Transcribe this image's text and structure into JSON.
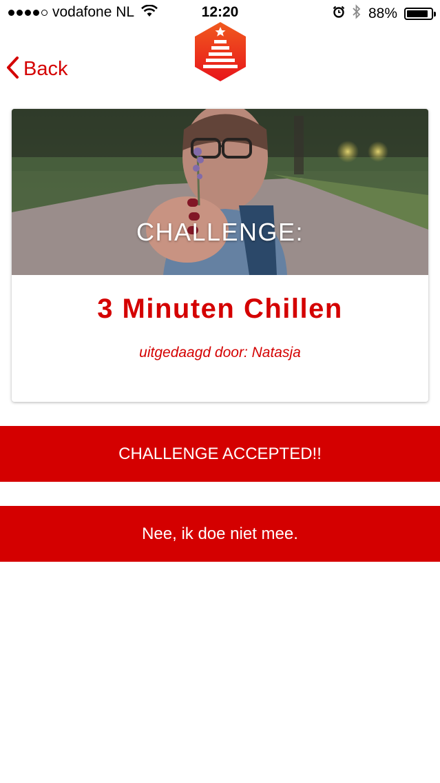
{
  "status_bar": {
    "signal_dots": [
      true,
      true,
      true,
      true,
      false
    ],
    "carrier": "vodafone NL",
    "time": "12:20",
    "battery": "88%",
    "battery_level": 0.88,
    "icons": [
      "wifi-icon",
      "alarm-icon",
      "bluetooth-icon",
      "battery-icon"
    ]
  },
  "nav": {
    "back_label": "Back",
    "logo_icon": "app-logo-icon"
  },
  "card": {
    "image_caption": "CHALLENGE:",
    "title": "3 Minuten Chillen",
    "subtitle": "uitgedaagd door: Natasja"
  },
  "actions": {
    "accept_label": "CHALLENGE ACCEPTED!!",
    "decline_label": "Nee, ik doe niet mee."
  },
  "colors": {
    "accent": "#d40000",
    "logo_top": "#f05a1e",
    "logo_bottom": "#e8151b",
    "background": "#ffffff"
  }
}
